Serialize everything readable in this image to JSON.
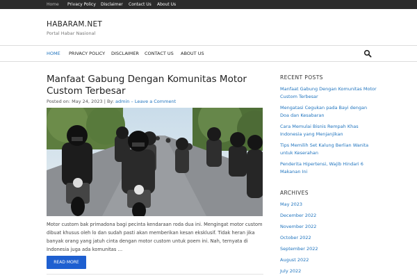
{
  "topbar": {
    "links": [
      "Home",
      "Privacy Policy",
      "Disclaimer",
      "Contact Us",
      "About Us"
    ]
  },
  "header": {
    "site_title": "HABARAM.NET",
    "site_description": "Portal Habar Nasional"
  },
  "nav": {
    "items": [
      "HOME",
      "PRIVACY POLICY",
      "DISCLAIMER",
      "CONTACT US",
      "ABOUT US"
    ],
    "search_icon": "search-icon"
  },
  "post": {
    "title": "Manfaat Gabung Dengan Komunitas Motor Custom Terbesar",
    "meta_prefix": "Posted on:",
    "date": "May 24, 2023",
    "by_label": "| By:",
    "author": "admin",
    "comment_link": "– Leave a Comment",
    "excerpt": "Motor custom bak primadona bagi pecinta kendaraan roda dua ini. Mengingat motor custom dibuat khusus oleh lo dan sudah pasti akan memberikan kesan eksklusif. Tidak heran jika banyak orang yang jatuh cinta dengan motor custom untuk poem ini. Nah, ternyata di Indonesia juga ada komunitas …",
    "read_more": "READ MORE"
  },
  "sidebar": {
    "recent_title": "RECENT POSTS",
    "recent_posts": [
      "Manfaat Gabung Dengan Komunitas Motor Custom Terbesar",
      "Mengatasi Cegukan pada Bayi dengan Doa dan Kesabaran",
      "Cara Memulai Bisnis Rempah Khas Indonesia yang Menjanjikan",
      "Tips Memilih Set Kalung Berlian Wanita untuk Keserahan",
      "Penderita Hipertensi, Wajib Hindari 6 Makanan Ini"
    ],
    "archives_title": "ARCHIVES",
    "archives": [
      "May 2023",
      "December 2022",
      "November 2022",
      "October 2022",
      "September 2022",
      "August 2022",
      "July 2022"
    ]
  },
  "colors": {
    "accent": "#1e73be",
    "button": "#1e5fd0",
    "topbar": "#2b2b2b"
  }
}
